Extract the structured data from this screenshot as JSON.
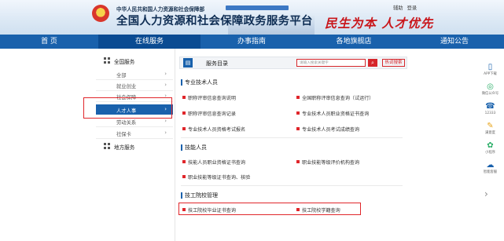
{
  "header": {
    "org_sub": "中华人民共和国人力资源和社会保障部",
    "title": "全国人力资源和社会保障政务服务平台",
    "slogan": "民生为本 人才优先",
    "top_links": [
      "辅助",
      "登录"
    ]
  },
  "nav": [
    {
      "label": "首 页",
      "active": false
    },
    {
      "label": "在线服务",
      "active": true
    },
    {
      "label": "办事指南",
      "active": false
    },
    {
      "label": "各地旗舰店",
      "active": false
    },
    {
      "label": "通知公告",
      "active": false
    }
  ],
  "sidebar": {
    "cat_national": "全国服务",
    "subs": [
      {
        "label": "全部",
        "active": false
      },
      {
        "label": "就业创业",
        "active": false
      },
      {
        "label": "社会保障",
        "active": false
      },
      {
        "label": "人才人事",
        "active": true
      },
      {
        "label": "劳动关系",
        "active": false
      },
      {
        "label": "社保卡",
        "active": false
      }
    ],
    "cat_local": "地方服务"
  },
  "catalog": {
    "title": "服务目录",
    "search_placeholder": "请输入搜索关键字",
    "search_button": "⌕",
    "hot_button": "热词搜索"
  },
  "sections": [
    {
      "title": "专业技术人员",
      "rows": [
        [
          "职称评审信息查询说明",
          "全国职称评审信息查询（试运行）"
        ],
        [
          "职称评审信息查询记录",
          "专业技术人员职业资格证书查询"
        ],
        [
          "专业技术人员资格考试报名",
          "专业技术人员考试成绩查询"
        ]
      ]
    },
    {
      "title": "技能人员",
      "rows": [
        [
          "技能人员职业资格证书查询",
          "职业技能等级评价机构查询"
        ],
        [
          "职业技能等级证书查询、核验",
          ""
        ]
      ]
    },
    {
      "title": "技工院校管理",
      "rows": [
        [
          "技工院校毕业证书查询",
          "技工院校学籍查询"
        ]
      ]
    }
  ],
  "rail": [
    {
      "icon": "phone-icon",
      "glyph": "▯",
      "label": "APP下载",
      "color": "#1961ac"
    },
    {
      "icon": "wechat-icon",
      "glyph": "◎",
      "label": "微信公众号",
      "color": "#2aae67"
    },
    {
      "icon": "hotline-icon",
      "glyph": "☎",
      "label": "12333",
      "color": "#1961ac"
    },
    {
      "icon": "survey-icon",
      "glyph": "✎",
      "label": "满意度",
      "color": "#e8a317"
    },
    {
      "icon": "mini-program-icon",
      "glyph": "✿",
      "label": "小程序",
      "color": "#2aae67"
    },
    {
      "icon": "service-icon",
      "glyph": "☁",
      "label": "智能客服",
      "color": "#1961ac"
    }
  ],
  "colors": {
    "nav_blue": "#1961ac",
    "nav_active": "#0a4b92",
    "accent_red": "#e0262b"
  }
}
